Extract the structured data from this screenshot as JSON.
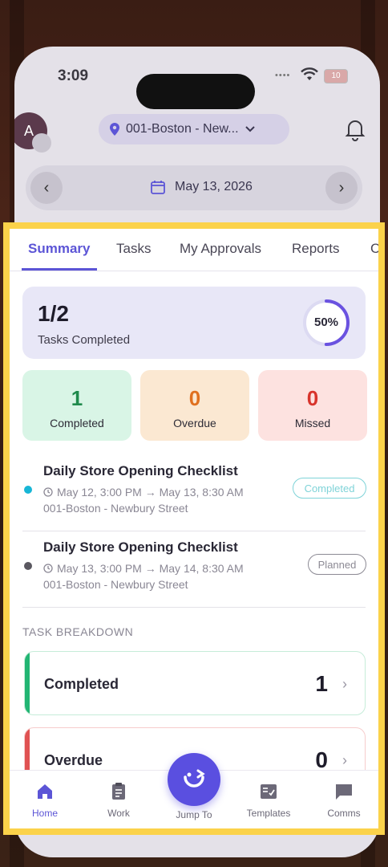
{
  "status_bar": {
    "time": "3:09",
    "battery": "10"
  },
  "header": {
    "avatar_initial": "A",
    "location": "001-Boston - New...",
    "date": "May 13, 2026"
  },
  "tabs": [
    "Summary",
    "Tasks",
    "My Approvals",
    "Reports",
    "C"
  ],
  "summary": {
    "value": "1/2",
    "label": "Tasks Completed",
    "percent_text": "50%",
    "percent": 0.5
  },
  "stats": [
    {
      "value": "1",
      "label": "Completed",
      "bg": "#d9f5e6",
      "color": "#1f8a4c"
    },
    {
      "value": "0",
      "label": "Overdue",
      "bg": "#fbe8d2",
      "color": "#e0701f"
    },
    {
      "value": "0",
      "label": "Missed",
      "bg": "#fde2e0",
      "color": "#d8342c"
    }
  ],
  "tasks": [
    {
      "title": "Daily Store Opening Checklist",
      "time": "May 12, 3:00 PM → May 13, 8:30 AM",
      "location": "001-Boston - Newbury Street",
      "status": "Completed",
      "dot_color": "#17b6d6",
      "badge_color": "#7fd3d8"
    },
    {
      "title": "Daily Store Opening Checklist",
      "time": "May 13, 3:00 PM → May 14, 8:30 AM",
      "location": "001-Boston - Newbury Street",
      "status": "Planned",
      "dot_color": "#5a5860",
      "badge_color": "#8c8a94"
    }
  ],
  "breakdown": {
    "title": "TASK BREAKDOWN",
    "items": [
      {
        "label": "Completed",
        "value": "1",
        "color": "#22b573",
        "border": "#c6ecd9"
      },
      {
        "label": "Overdue",
        "value": "0",
        "color": "#e05252",
        "border": "#f6cccc"
      }
    ]
  },
  "bottom_nav": {
    "home": "Home",
    "work": "Work",
    "jump_to": "Jump To",
    "templates": "Templates",
    "comms": "Comms"
  },
  "colors": {
    "accent": "#5c55d6",
    "highlight_border": "#fbd24a"
  }
}
